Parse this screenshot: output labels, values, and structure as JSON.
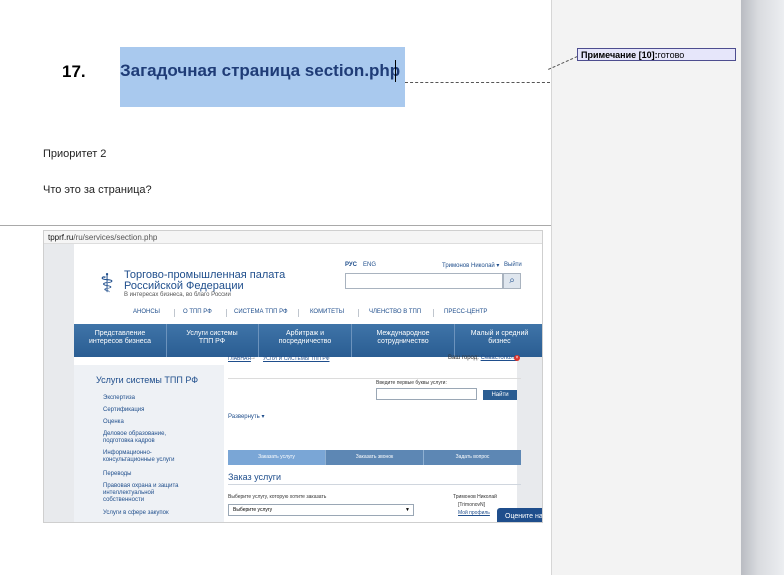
{
  "document": {
    "item_number": "17.",
    "heading": "Загадочная страница section.php",
    "priority": "Приоритет 2",
    "question": "Что это за страница?"
  },
  "comment": {
    "label": "Примечание [10]:",
    "text": "готово"
  },
  "screenshot": {
    "url_domain": "tpprf.ru",
    "url_path": "/ru/services/section.php",
    "org_line1": "Торгово-промышленная палата",
    "org_line2": "Российской Федерации",
    "org_tagline": "В интересах бизнеса, во благо России",
    "lang_ru": "РУС",
    "lang_en": "ENG",
    "user_name": "Тримонов Николай ▾",
    "exit": "Выйти",
    "top_nav": [
      "АНОНСЫ",
      "О ТПП РФ",
      "СИСТЕМА ТПП РФ",
      "КОМИТЕТЫ",
      "ЧЛЕНСТВО В ТПП",
      "ПРЕСС-ЦЕНТР"
    ],
    "main_nav": [
      {
        "line1": "Представление",
        "line2": "интересов бизнеса"
      },
      {
        "line1": "Услуги системы",
        "line2": "ТПП РФ"
      },
      {
        "line1": "Арбитраж и",
        "line2": "посредничество"
      },
      {
        "line1": "Международное",
        "line2": "сотрудничество"
      },
      {
        "line1": "Малый и средний",
        "line2": "бизнес"
      }
    ],
    "breadcrumb_home": "ГЛАВНАЯ",
    "breadcrumb_current": "УСЛУГИ СИСТЕМЫ ТПП РФ",
    "city_label": "Ваш город:",
    "city_value": "Севастополь",
    "sidebar_title": "Услуги системы ТПП РФ",
    "sidebar_items": [
      {
        "line1": "Экспертиза",
        "line2": ""
      },
      {
        "line1": "Сертификация",
        "line2": ""
      },
      {
        "line1": "Оценка",
        "line2": ""
      },
      {
        "line1": "Деловое образование,",
        "line2": "подготовка кадров"
      },
      {
        "line1": "Информационно-",
        "line2": "консультационные услуги"
      },
      {
        "line1": "Переводы",
        "line2": ""
      },
      {
        "line1": "Правовая охрана и защита",
        "line2": "интеллектуальной",
        "line3": "собственности"
      },
      {
        "line1": "Услуги в сфере закупок",
        "line2": ""
      }
    ],
    "find_label": "Введите первые буквы услуги:",
    "find_button": "Найти",
    "expand": "Развернуть ▾",
    "tabs": [
      "Заказать услугу",
      "Заказать звонок",
      "Задать вопрос"
    ],
    "order_title": "Заказ услуги",
    "choose_label": "Выберите услугу, которую хотите заказать",
    "choose_select": "Выберите услугу",
    "profile_name": "Тримонов Николай",
    "profile_login": "[TrimonovN]",
    "profile_link": "Мой профиль",
    "rate_button": "Оцените на"
  }
}
